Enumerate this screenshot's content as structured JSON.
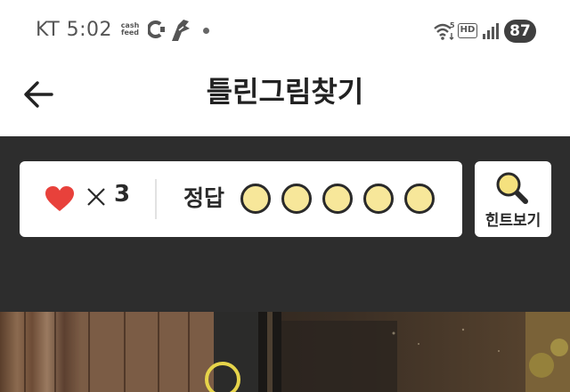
{
  "status_bar": {
    "carrier_time": "KT 5:02",
    "cashfeed_top": "cash",
    "cashfeed_bottom": "feed",
    "network": "5",
    "hd": "HD",
    "battery": "87"
  },
  "header": {
    "title": "틀린그림찾기",
    "back_icon": "arrow-left-icon"
  },
  "game_info": {
    "lives_icon": "heart-icon",
    "lives_count": "3",
    "answer_label": "정답",
    "answers_total": 5,
    "answers_found": 0
  },
  "hint_button": {
    "label": "힌트보기",
    "icon": "magnifier-icon"
  },
  "colors": {
    "dark_bg": "#2d2d2d",
    "heart": "#e8413b",
    "slot_fill": "#f7e79a",
    "slot_stroke": "#2a2a2a",
    "marker": "#e6d44a"
  }
}
